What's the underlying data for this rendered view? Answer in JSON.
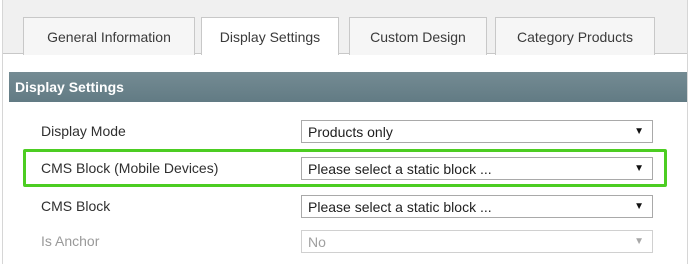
{
  "tabs": [
    {
      "label": "General Information",
      "active": false
    },
    {
      "label": "Display Settings",
      "active": true
    },
    {
      "label": "Custom Design",
      "active": false
    },
    {
      "label": "Category Products",
      "active": false
    }
  ],
  "section": {
    "title": "Display Settings"
  },
  "fields": [
    {
      "label": "Display Mode",
      "value": "Products only",
      "disabled": false
    },
    {
      "label": "CMS Block (Mobile Devices)",
      "value": "Please select a static block ...",
      "disabled": false,
      "highlighted": true
    },
    {
      "label": "CMS Block",
      "value": "Please select a static block ...",
      "disabled": false
    },
    {
      "label": "Is Anchor",
      "value": "No",
      "disabled": true
    }
  ],
  "icons": {
    "dropdown": "chevron-down-icon"
  },
  "colors": {
    "section_bar": "#6a838b",
    "highlight": "#4ccd22"
  }
}
